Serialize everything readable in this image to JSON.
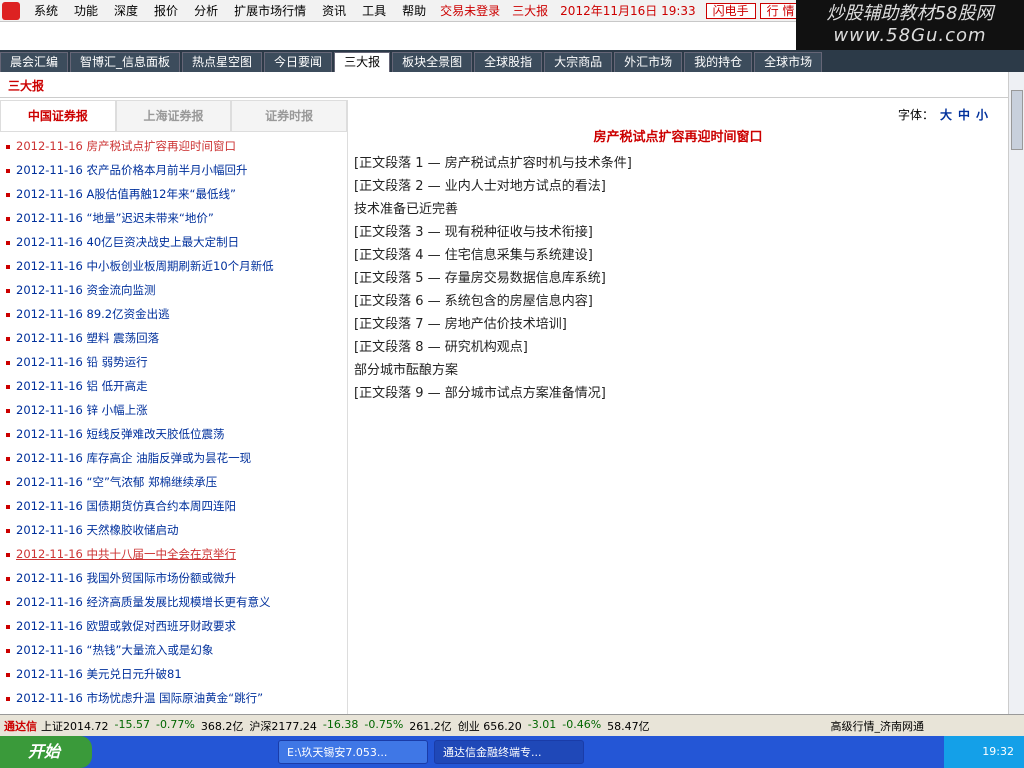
{
  "menu": {
    "items": [
      "系统",
      "功能",
      "深度",
      "报价",
      "分析",
      "扩展市场行情",
      "资讯",
      "工具",
      "帮助"
    ],
    "login_status": "交易未登录",
    "section": "三大报",
    "datetime": "2012年11月16日 19:33",
    "flash_btn": "闪电手",
    "quote_btn": "行 情"
  },
  "brand": {
    "line1": "炒股辅助教材58股网",
    "line2": "www.58Gu.com"
  },
  "tabs": [
    "晨会汇编",
    "智博汇_信息面板",
    "热点星空图",
    "今日要闻",
    "三大报",
    "板块全景图",
    "全球股指",
    "大宗商品",
    "外汇市场",
    "我的持仓",
    "全球市场"
  ],
  "page_title": "三大报",
  "subtabs": [
    "中国证券报",
    "上海证券报",
    "证券时报"
  ],
  "font_label": "字体：",
  "font_sizes": [
    "大",
    "中",
    "小"
  ],
  "news": [
    {
      "date": "2012-11-16",
      "title": "房产税试点扩容再迎时间窗口",
      "style": "hl"
    },
    {
      "date": "2012-11-16",
      "title": "农产品价格本月前半月小幅回升",
      "style": ""
    },
    {
      "date": "2012-11-16",
      "title": "A股估值再触12年来“最低线”",
      "style": ""
    },
    {
      "date": "2012-11-16",
      "title": "“地量”迟迟未带来“地价”",
      "style": ""
    },
    {
      "date": "2012-11-16",
      "title": "40亿巨资决战史上最大定制日",
      "style": ""
    },
    {
      "date": "2012-11-16",
      "title": "中小板创业板周期刷新近10个月新低",
      "style": ""
    },
    {
      "date": "2012-11-16",
      "title": "资金流向监测",
      "style": ""
    },
    {
      "date": "2012-11-16",
      "title": "89.2亿资金出逃",
      "style": ""
    },
    {
      "date": "2012-11-16",
      "title": "塑料 震荡回落",
      "style": ""
    },
    {
      "date": "2012-11-16",
      "title": "铅 弱势运行",
      "style": ""
    },
    {
      "date": "2012-11-16",
      "title": "铝 低开高走",
      "style": ""
    },
    {
      "date": "2012-11-16",
      "title": "锌 小幅上涨",
      "style": ""
    },
    {
      "date": "2012-11-16",
      "title": "短线反弹难改天胶低位震荡",
      "style": ""
    },
    {
      "date": "2012-11-16",
      "title": "库存高企 油脂反弹或为昙花一现",
      "style": ""
    },
    {
      "date": "2012-11-16",
      "title": "“空”气浓郁 郑棉继续承压",
      "style": ""
    },
    {
      "date": "2012-11-16",
      "title": "国债期货仿真合约本周四连阳",
      "style": ""
    },
    {
      "date": "2012-11-16",
      "title": "天然橡胶收储启动",
      "style": ""
    },
    {
      "date": "2012-11-16",
      "title": "中共十八届一中全会在京举行",
      "style": "hl-u"
    },
    {
      "date": "2012-11-16",
      "title": "我国外贸国际市场份额或微升",
      "style": ""
    },
    {
      "date": "2012-11-16",
      "title": "经济高质量发展比规模增长更有意义",
      "style": ""
    },
    {
      "date": "2012-11-16",
      "title": "欧盟或敦促对西班牙财政要求",
      "style": ""
    },
    {
      "date": "2012-11-16",
      "title": "“热钱”大量流入或是幻象",
      "style": ""
    },
    {
      "date": "2012-11-16",
      "title": "美元兑日元升破81",
      "style": ""
    },
    {
      "date": "2012-11-16",
      "title": "市场忧虑升温 国际原油黄金“跳行”",
      "style": ""
    }
  ],
  "article": {
    "headline": "房产税试点扩容再迎时间窗口",
    "paragraphs": [
      {
        "text": "[正文段落 1 — 房产税试点扩容时机与技术条件]",
        "style": ""
      },
      {
        "text": "[正文段落 2 — 业内人士对地方试点的看法]",
        "style": ""
      },
      {
        "text": "技术准备已近完善",
        "style": "sub"
      },
      {
        "text": "[正文段落 3 — 现有税种征收与技术衔接]",
        "style": ""
      },
      {
        "text": "[正文段落 4 — 住宅信息采集与系统建设]",
        "style": ""
      },
      {
        "text": "[正文段落 5 — 存量房交易数据信息库系统]",
        "style": ""
      },
      {
        "text": "[正文段落 6 — 系统包含的房屋信息内容]",
        "style": ""
      },
      {
        "text": "[正文段落 7 — 房地产估价技术培训]",
        "style": ""
      },
      {
        "text": "[正文段落 8 — 研究机构观点]",
        "style": ""
      },
      {
        "text": "部分城市酝酿方案",
        "style": "sub"
      },
      {
        "text": "[正文段落 9 — 部分城市试点方案准备情况]",
        "style": ""
      }
    ]
  },
  "ticker": {
    "name": "通达信",
    "items": [
      {
        "text": "上证2014.72",
        "cls": "k"
      },
      {
        "text": "-15.57",
        "cls": "dn"
      },
      {
        "text": "-0.77%",
        "cls": "dn"
      },
      {
        "text": "368.2亿",
        "cls": "k"
      },
      {
        "text": "沪深2177.24",
        "cls": "k"
      },
      {
        "text": "-16.38",
        "cls": "dn"
      },
      {
        "text": "-0.75%",
        "cls": "dn"
      },
      {
        "text": "261.2亿",
        "cls": "k"
      },
      {
        "text": "创业 656.20",
        "cls": "k"
      },
      {
        "text": "-3.01",
        "cls": "dn"
      },
      {
        "text": "-0.46%",
        "cls": "dn"
      },
      {
        "text": "58.47亿",
        "cls": "k"
      }
    ],
    "right": "高级行情_济南网通"
  },
  "taskbar": {
    "start": "开始",
    "windows": [
      "E:\\玖天锡安7.053...",
      "通达信金融终端专..."
    ],
    "clock": "19:32"
  }
}
